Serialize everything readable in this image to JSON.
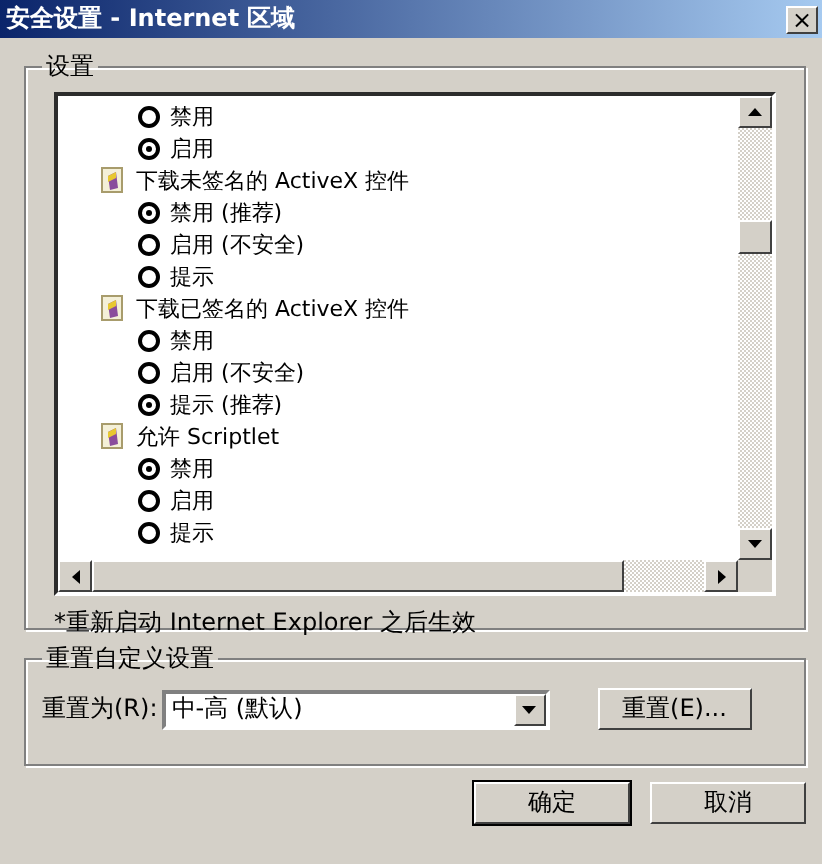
{
  "window": {
    "title": "安全设置 - Internet 区域",
    "close": "×"
  },
  "settings": {
    "label": "设置",
    "items": [
      {
        "kind": "option",
        "label": "禁用",
        "selected": false
      },
      {
        "kind": "option",
        "label": "启用",
        "selected": true
      },
      {
        "kind": "header",
        "label": "下载未签名的 ActiveX 控件"
      },
      {
        "kind": "option",
        "label": "禁用 (推荐)",
        "selected": true
      },
      {
        "kind": "option",
        "label": "启用 (不安全)",
        "selected": false
      },
      {
        "kind": "option",
        "label": "提示",
        "selected": false
      },
      {
        "kind": "header",
        "label": "下载已签名的 ActiveX 控件"
      },
      {
        "kind": "option",
        "label": "禁用",
        "selected": false
      },
      {
        "kind": "option",
        "label": "启用 (不安全)",
        "selected": false
      },
      {
        "kind": "option",
        "label": "提示 (推荐)",
        "selected": true
      },
      {
        "kind": "header",
        "label": "允许 Scriptlet"
      },
      {
        "kind": "option",
        "label": "禁用",
        "selected": true
      },
      {
        "kind": "option",
        "label": "启用",
        "selected": false
      },
      {
        "kind": "option",
        "label": "提示",
        "selected": false
      }
    ],
    "note": "*重新启动 Internet Explorer 之后生效"
  },
  "reset": {
    "label": "重置自定义设置",
    "field_label": "重置为(R):",
    "value": "中-高 (默认)",
    "button": "重置(E)..."
  },
  "buttons": [
    "确定",
    "取消"
  ]
}
